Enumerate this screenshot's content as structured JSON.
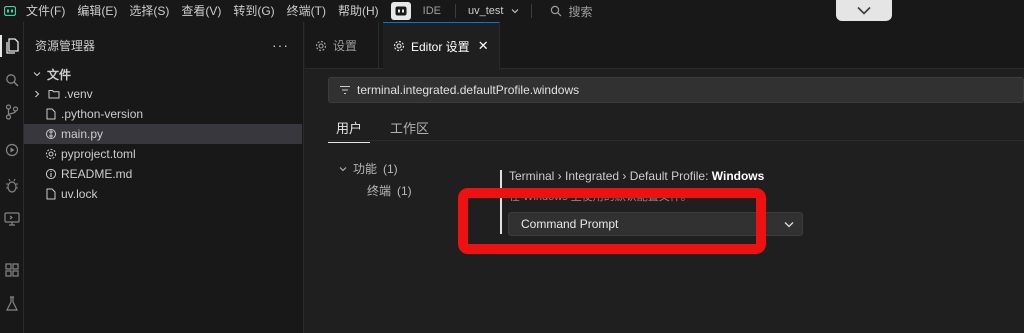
{
  "menu": {
    "items": [
      "文件(F)",
      "编辑(E)",
      "选择(S)",
      "查看(V)",
      "转到(G)",
      "终端(T)",
      "帮助(H)"
    ],
    "ide_label": "IDE",
    "project_name": "uv_test",
    "search_placeholder": "搜索"
  },
  "sidebar": {
    "title": "资源管理器",
    "root_label": "文件",
    "items": [
      {
        "label": ".venv",
        "icon": "folder-icon"
      },
      {
        "label": ".python-version",
        "icon": "file-icon"
      },
      {
        "label": "main.py",
        "icon": "python-file-icon"
      },
      {
        "label": "pyproject.toml",
        "icon": "settings-file-icon"
      },
      {
        "label": "README.md",
        "icon": "info-file-icon"
      },
      {
        "label": "uv.lock",
        "icon": "file-icon"
      }
    ]
  },
  "tabs": [
    {
      "label": "设置",
      "active": false
    },
    {
      "label": "Editor 设置",
      "active": true
    }
  ],
  "settings": {
    "search_value": "terminal.integrated.defaultProfile.windows",
    "scope_tabs": [
      "用户",
      "工作区"
    ],
    "toc": {
      "group_label": "功能",
      "group_count": "(1)",
      "child_label": "终端",
      "child_count": "(1)"
    },
    "setting": {
      "title_prefix": "Terminal › Integrated › Default Profile: ",
      "title_bold": "Windows",
      "description": "在 Windows 上使用的默认配置文件。",
      "selected_value": "Command Prompt"
    }
  },
  "colors": {
    "highlight": "#ee1111",
    "accent": "#0078d4"
  }
}
